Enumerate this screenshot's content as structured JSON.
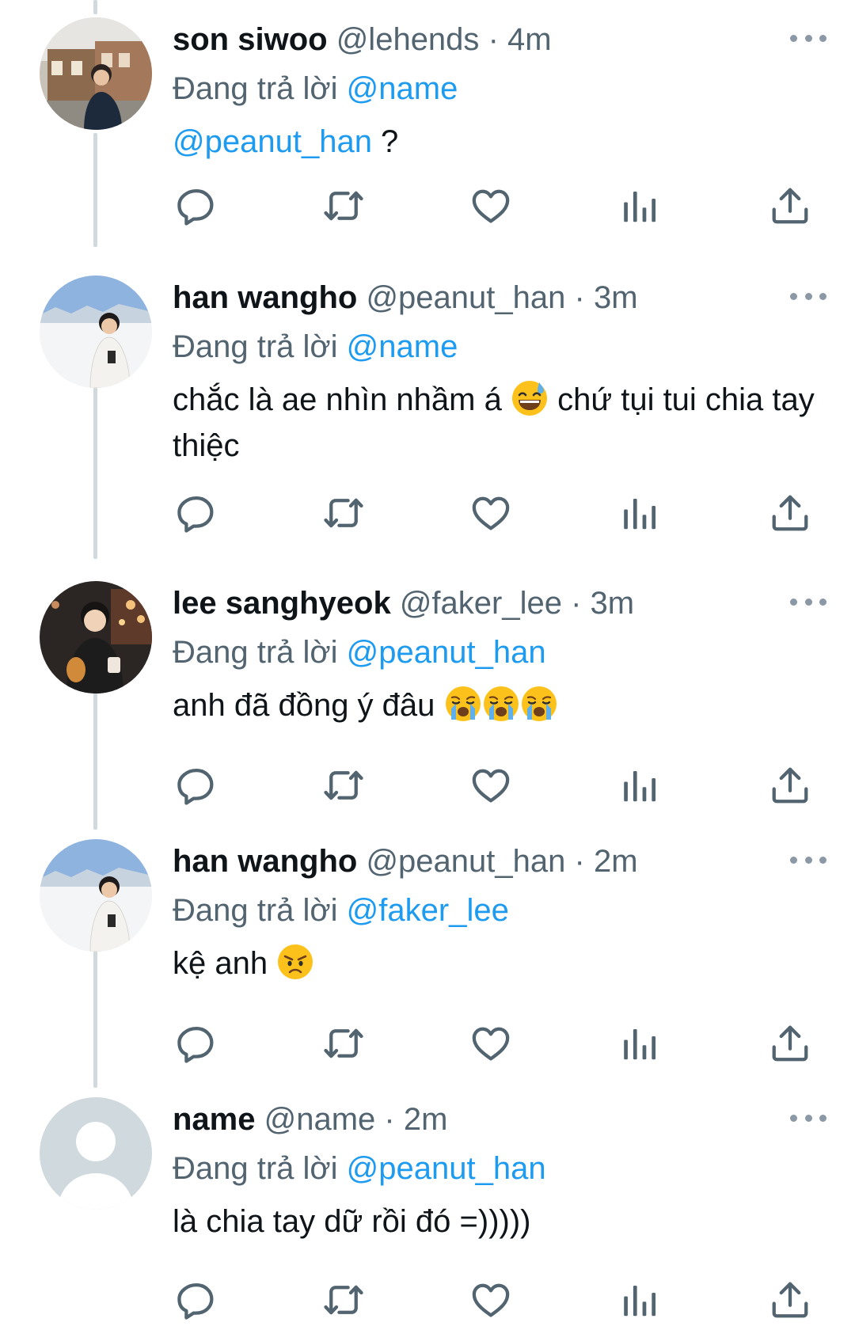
{
  "reply_prefix": "Đang trả lời",
  "tweets": [
    {
      "display_name": "son siwoo",
      "handle": "@lehends",
      "separator": "·",
      "time": "4m",
      "reply_to": "@name",
      "text_mention": "@peanut_han",
      "text": " ?"
    },
    {
      "display_name": "han wangho",
      "handle": "@peanut_han",
      "separator": "·",
      "time": "3m",
      "reply_to": "@name",
      "text_a": "chắc là ae nhìn nhầm á ",
      "text_b": " chứ tụi tui chia tay thiệc"
    },
    {
      "display_name": "lee sanghyeok",
      "handle": "@faker_lee",
      "separator": "·",
      "time": "3m",
      "reply_to": "@peanut_han",
      "text": "anh đã đồng ý đâu "
    },
    {
      "display_name": "han wangho",
      "handle": "@peanut_han",
      "separator": "·",
      "time": "2m",
      "reply_to": "@faker_lee",
      "text": "kệ anh "
    },
    {
      "display_name": "name",
      "handle": "@name",
      "separator": "·",
      "time": "2m",
      "reply_to": "@peanut_han",
      "text": "là chia tay dữ rồi đó =)))))"
    }
  ],
  "icons": {
    "reply": "reply-icon",
    "retweet": "retweet-icon",
    "like": "heart-icon",
    "views": "views-icon",
    "share": "share-icon",
    "more": "more-icon"
  },
  "colors": {
    "link": "#1d9bf0",
    "secondary": "#536471",
    "icon": "#536471",
    "thread_line": "#cfd9de"
  }
}
